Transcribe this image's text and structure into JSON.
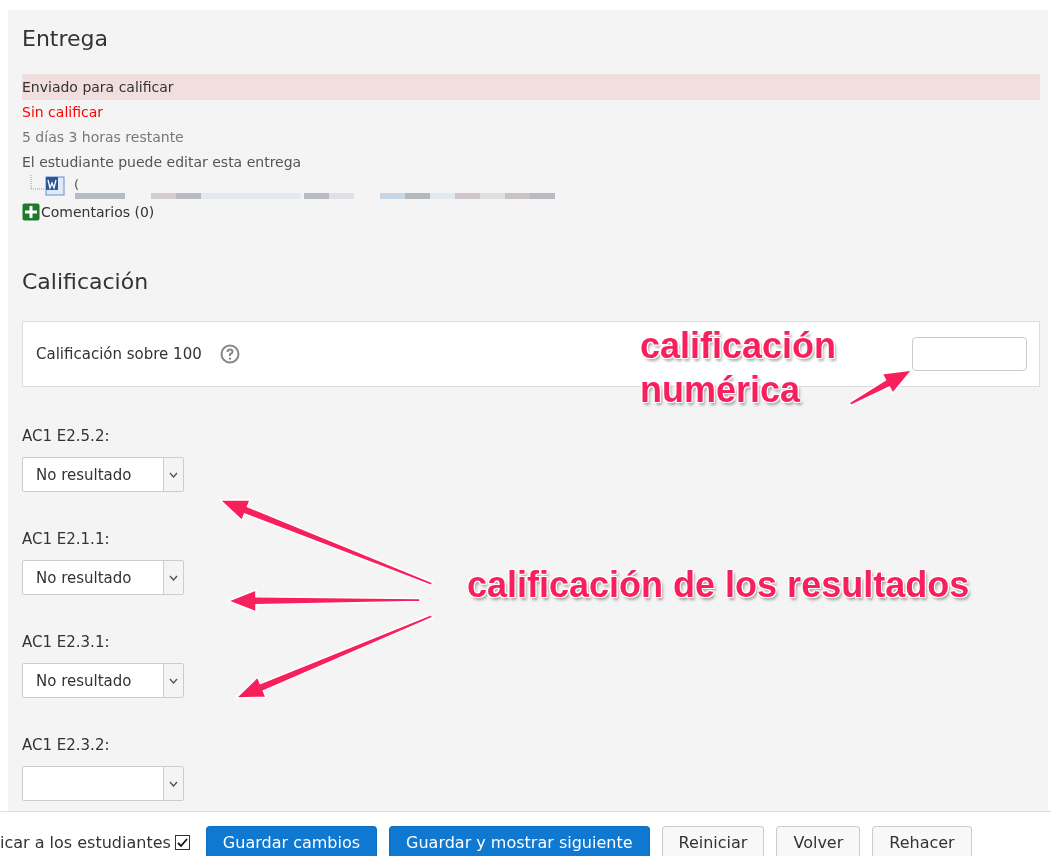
{
  "submission": {
    "heading": "Entrega",
    "status": "Enviado para calificar",
    "grading_status": "Sin calificar",
    "time_remaining": "5 días 3 horas restante",
    "editable_note": "El estudiante puede editar esta entrega",
    "file": {
      "name": "("
    },
    "comments": {
      "label": "Comentarios (0)",
      "expanded": false
    }
  },
  "grade": {
    "heading": "Calificación",
    "label": "Calificación sobre 100"
  },
  "outcomes": [
    {
      "label": "AC1 E2.5.2:",
      "value": "No resultado"
    },
    {
      "label": "AC1 E2.1.1:",
      "value": "No resultado"
    },
    {
      "label": "AC1 E2.3.1:",
      "value": "No resultado"
    },
    {
      "label": "AC1 E2.3.2:"
    }
  ],
  "footer": {
    "notify": {
      "label": "icar a los estudiantes",
      "checked": true
    },
    "buttons": [
      {
        "label": "Guardar cambios",
        "kind": "primary"
      },
      {
        "label": "Guardar y mostrar siguiente",
        "kind": "primary"
      },
      {
        "label": "Reiniciar",
        "kind": "default"
      },
      {
        "label": "Volver",
        "kind": "default"
      },
      {
        "label": "Rehacer",
        "kind": "default"
      }
    ]
  },
  "annotations": [
    {
      "text": "calificación numérica"
    },
    {
      "text": "calificación de los resultados"
    }
  ]
}
